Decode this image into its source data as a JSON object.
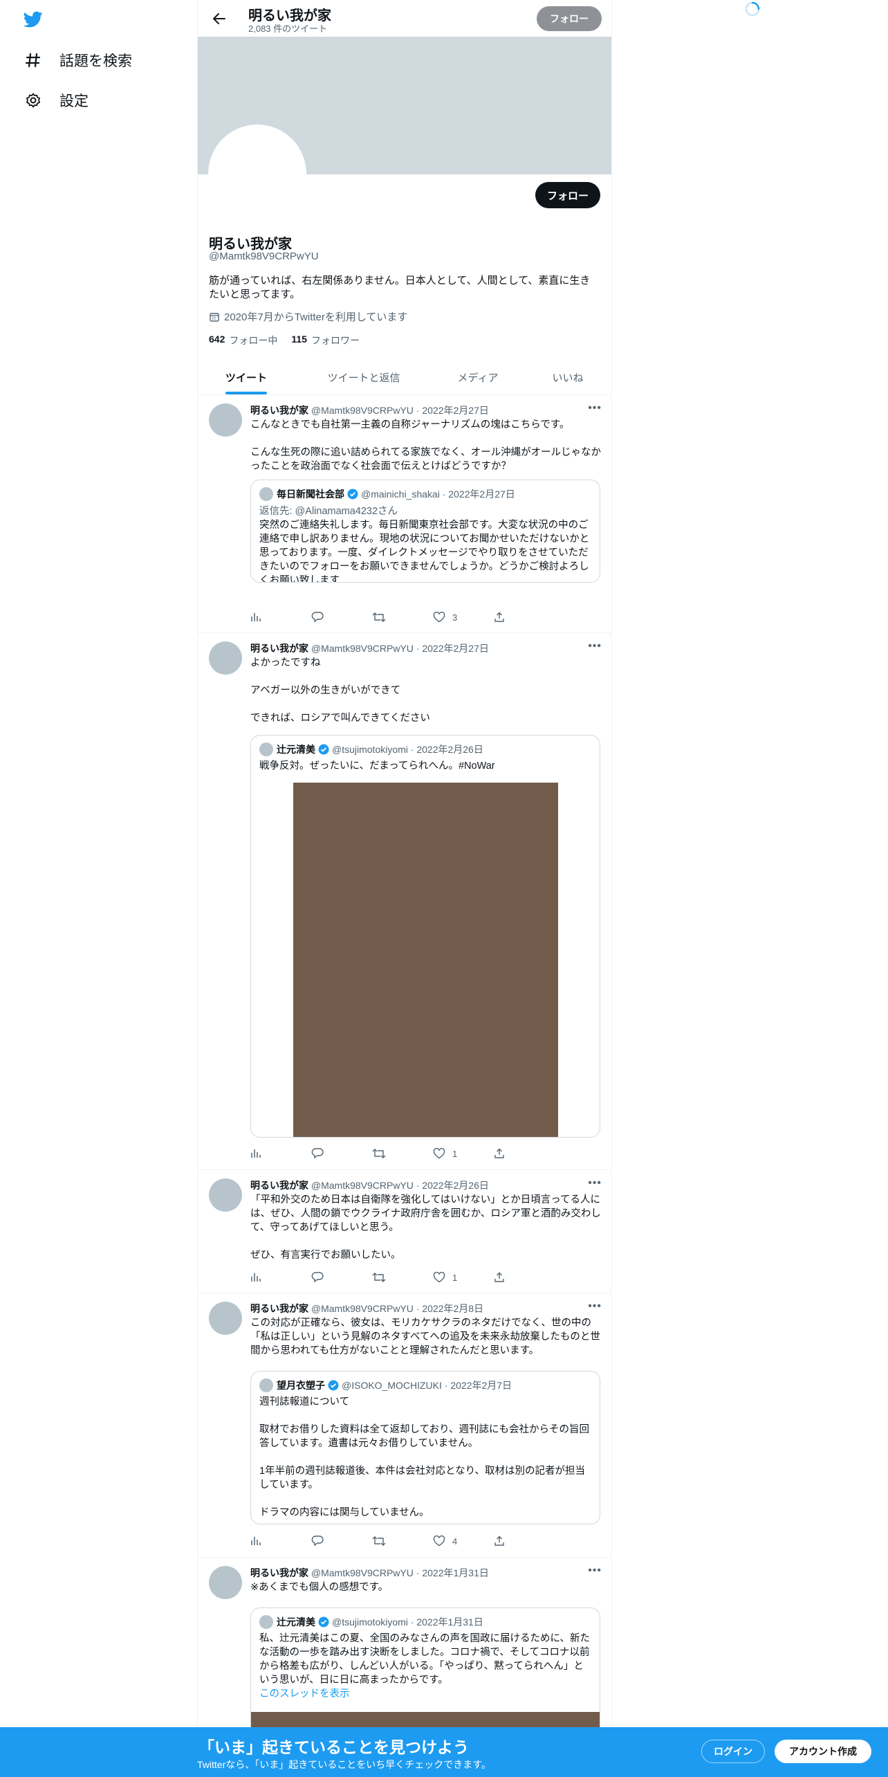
{
  "sidebar": {
    "logo": "twitter-bird-icon",
    "items": [
      {
        "label": "話題を検索",
        "icon": "hashtag-icon"
      },
      {
        "label": "設定",
        "icon": "gear-icon"
      }
    ]
  },
  "header": {
    "name": "明るい我が家",
    "tweet_count": "2,083 件のツイート",
    "follow_label": "フォロー"
  },
  "profile": {
    "follow_label": "フォロー",
    "name": "明るい我が家",
    "handle": "@Mamtk98V9CRPwYU",
    "bio": "筋が通っていれば、右左関係ありません。日本人として、人間として、素直に生きたいと思ってます。",
    "joined": "2020年7月からTwitterを利用しています",
    "following_count": "642",
    "following_label": "フォロー中",
    "followers_count": "115",
    "followers_label": "フォロワー"
  },
  "tabs": [
    {
      "label": "ツイート",
      "active": true
    },
    {
      "label": "ツイートと返信",
      "active": false
    },
    {
      "label": "メディア",
      "active": false
    },
    {
      "label": "いいね",
      "active": false
    }
  ],
  "tweets": [
    {
      "name": "明るい我が家",
      "meta": "@Mamtk98V9CRPwYU · 2022年2月27日",
      "text": "こんなときでも自社第一主義の自称ジャーナリズムの塊はこちらです。\n\nこんな生死の際に追い詰められてる家族でなく、オール沖縄がオールじゃなかったことを政治面でなく社会面で伝えとけばどうですか？",
      "quote": {
        "name": "毎日新聞社会部",
        "meta": "@mainichi_shakai · 2022年2月27日",
        "reply_to": "返信先: @Alinamama4232さん",
        "text": "突然のご連絡失礼します。毎日新聞東京社会部です。大変な状況の中のご連絡で申し訳ありません。現地の状況についてお聞かせいただけないかと思っております。一度、ダイレクトメッセージでやり取りをさせていただきたいのでフォローをお願いできませんでしょうか。どうかご検討よろしくお願い致します"
      },
      "likes": "3"
    },
    {
      "name": "明るい我が家",
      "meta": "@Mamtk98V9CRPwYU · 2022年2月27日",
      "text": "よかったですね\n\nアベガー以外の生きがいができて\n\nできれば、ロシアで叫んできてください",
      "quote": {
        "name": "辻元清美",
        "meta": "@tsujimotokiyomi · 2022年2月26日",
        "text": "戦争反対。ぜったいに、だまってられへん。#NoWar",
        "media_color": "#735b4b"
      },
      "likes": "1"
    },
    {
      "name": "明るい我が家",
      "meta": "@Mamtk98V9CRPwYU · 2022年2月26日",
      "text": "「平和外交のため日本は自衛隊を強化してはいけない」とか日頃言ってる人には、ぜひ、人間の鎖でウクライナ政府庁舎を囲むか、ロシア軍と酒酌み交わして、守ってあげてほしいと思う。\n\nぜひ、有言実行でお願いしたい。",
      "likes": "1"
    },
    {
      "name": "明るい我が家",
      "meta": "@Mamtk98V9CRPwYU · 2022年2月8日",
      "text": "この対応が正確なら、彼女は、モリカケサクラのネタだけでなく、世の中の「私は正しい」という見解のネタすべてへの追及を未来永劫放棄したものと世間から思われても仕方がないことと理解されたんだと思います。",
      "quote": {
        "name": "望月衣塑子",
        "meta": "@ISOKO_MOCHIZUKI · 2022年2月7日",
        "text": "週刊誌報道について\n\n取材でお借りした資料は全て返却しており、週刊誌にも会社からその旨回答しています。遺書は元々お借りしていません。\n\n1年半前の週刊誌報道後、本件は会社対応となり、取材は別の記者が担当しています。\n\nドラマの内容には関与していません。"
      },
      "likes": "4"
    },
    {
      "name": "明るい我が家",
      "meta": "@Mamtk98V9CRPwYU · 2022年1月31日",
      "text": "※あくまでも個人の感想です。",
      "quote": {
        "name": "辻元清美",
        "meta": "@tsujimotokiyomi · 2022年1月31日",
        "text": "私、辻元清美はこの夏、全国のみなさんの声を国政に届けるために、新たな活動の一歩を踏み出す決断をしました。コロナ禍で、そしてコロナ以前から格差も広がり、しんどい人がいる。「やっぱり、黙ってられへん」という思いが、日に日に高まったからです。",
        "thread_link": "このスレッドを表示",
        "media_color": "#735b4b"
      }
    }
  ],
  "bottom_bar": {
    "title": "「いま」起きていることを見つけよう",
    "subtitle": "Twitterなら、「いま」起きていることをいち早くチェックできます。",
    "login_label": "ログイン",
    "signup_label": "アカウント作成"
  },
  "colors": {
    "accent": "#1d9bf0",
    "banner": "#cfd9de",
    "text": "#0f1419",
    "muted": "#536471"
  }
}
